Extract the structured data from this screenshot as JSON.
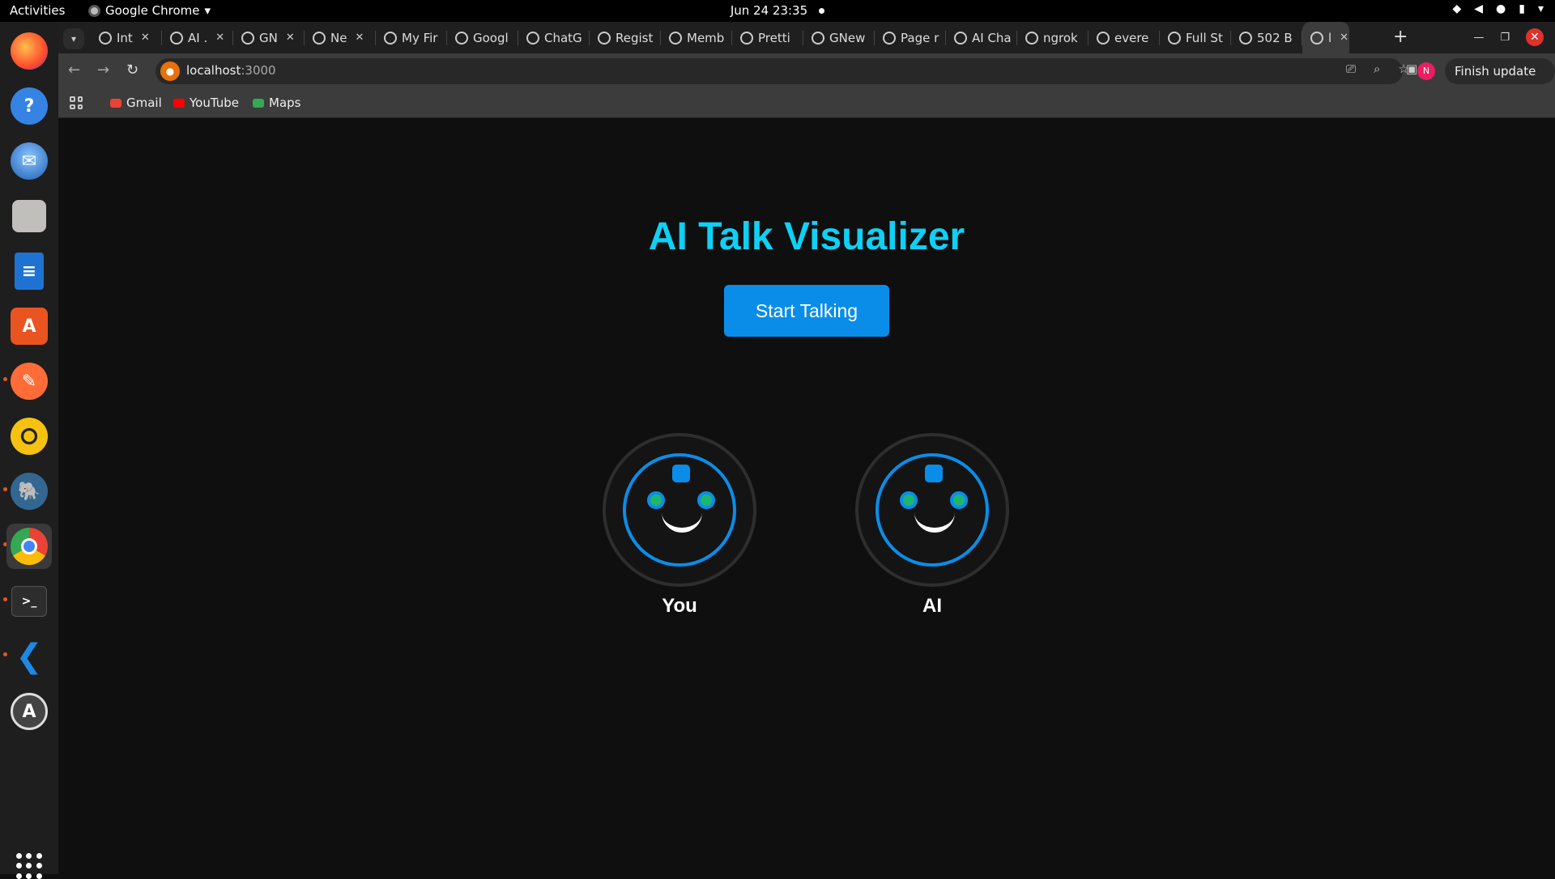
{
  "topbar": {
    "activities": "Activities",
    "app_name": "Google Chrome",
    "clock": "Jun 24  23:35"
  },
  "dock": {
    "items": [
      "firefox-icon",
      "help-icon",
      "thunderbird-icon",
      "files-icon",
      "writer-icon",
      "app-center-icon",
      "postman-icon",
      "rhythmbox-icon",
      "pgadmin-icon",
      "chrome-icon",
      "terminal-icon",
      "vscode-icon",
      "software-updater-icon"
    ]
  },
  "browser": {
    "tabs": [
      {
        "label": "Int",
        "closable": true
      },
      {
        "label": "AI .",
        "closable": true
      },
      {
        "label": "GN",
        "closable": true
      },
      {
        "label": "Ne",
        "closable": true
      },
      {
        "label": "My Fir",
        "closable": false
      },
      {
        "label": "Googl",
        "closable": false
      },
      {
        "label": "ChatG",
        "closable": false
      },
      {
        "label": "Regist",
        "closable": false
      },
      {
        "label": "Memb",
        "closable": false
      },
      {
        "label": "Pretti",
        "closable": false
      },
      {
        "label": "GNew",
        "closable": false
      },
      {
        "label": "Page r",
        "closable": false
      },
      {
        "label": "AI Cha",
        "closable": false
      },
      {
        "label": "ngrok",
        "closable": false
      },
      {
        "label": "evere",
        "closable": false
      },
      {
        "label": "Full St",
        "closable": false
      },
      {
        "label": "502 B",
        "closable": false
      },
      {
        "label": "l",
        "closable": true,
        "active": true
      }
    ],
    "url_host": "localhost",
    "url_port": ":3000",
    "finish_update": "Finish update",
    "profile_initial": "N",
    "bookmarks": [
      {
        "label": "Gmail",
        "color": "#ea4335"
      },
      {
        "label": "YouTube",
        "color": "#ff0000"
      },
      {
        "label": "Maps",
        "color": "#34a853"
      }
    ]
  },
  "page": {
    "title": "AI Talk Visualizer",
    "start_button": "Start Talking",
    "faces": [
      {
        "label": "You"
      },
      {
        "label": "AI"
      }
    ]
  },
  "colors": {
    "title": "#0fd0f5",
    "accent_blue": "#0a8de8",
    "eye_green": "#1fb56e"
  }
}
